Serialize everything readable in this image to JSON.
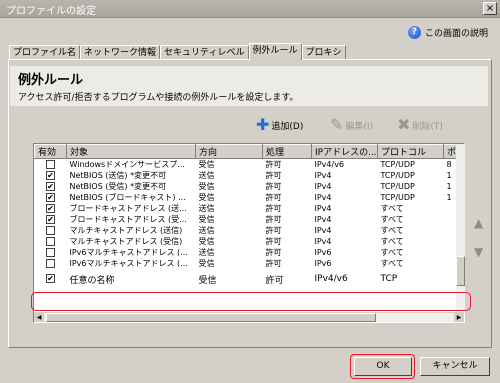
{
  "window": {
    "title": "プロファイルの設定",
    "close_label": "×"
  },
  "help": {
    "label": "この画面の説明",
    "icon": "help-icon"
  },
  "tabs": [
    {
      "label": "プロファイル名"
    },
    {
      "label": "ネットワーク情報"
    },
    {
      "label": "セキュリティレベル"
    },
    {
      "label": "例外ルール",
      "active": true
    },
    {
      "label": "プロキシ"
    }
  ],
  "section": {
    "title": "例外ルール",
    "description": "アクセス許可/拒否するプログラムや接続の例外ルールを設定します。"
  },
  "actions": {
    "add": "追加(D)",
    "edit": "編集(I)",
    "delete": "削除(T)"
  },
  "table": {
    "columns": [
      "有効",
      "対象",
      "方向",
      "処理",
      "IPアドレスの...",
      "プロトコル",
      "ポ"
    ],
    "rows": [
      {
        "checked": false,
        "target": "Windowsドメインサービスプ...",
        "direction": "受信",
        "action": "許可",
        "ip": "IPv4/v6",
        "protocol": "TCP/UDP",
        "port": "8"
      },
      {
        "checked": true,
        "target": "NetBIOS (送信) *変更不可",
        "direction": "送信",
        "action": "許可",
        "ip": "IPv4",
        "protocol": "TCP/UDP",
        "port": "1"
      },
      {
        "checked": true,
        "target": "NetBIOS (受信) *変更不可",
        "direction": "受信",
        "action": "許可",
        "ip": "IPv4",
        "protocol": "TCP/UDP",
        "port": "1"
      },
      {
        "checked": true,
        "target": "NetBIOS (ブロードキャスト) ...",
        "direction": "受信",
        "action": "許可",
        "ip": "IPv4",
        "protocol": "TCP/UDP",
        "port": "1"
      },
      {
        "checked": true,
        "target": "ブロードキャストアドレス (送...",
        "direction": "送信",
        "action": "許可",
        "ip": "IPv4",
        "protocol": "すべて",
        "port": ""
      },
      {
        "checked": true,
        "target": "ブロードキャストアドレス (受...",
        "direction": "受信",
        "action": "許可",
        "ip": "IPv4",
        "protocol": "すべて",
        "port": ""
      },
      {
        "checked": false,
        "target": "マルチキャストアドレス (送信)",
        "direction": "送信",
        "action": "許可",
        "ip": "IPv4",
        "protocol": "すべて",
        "port": ""
      },
      {
        "checked": false,
        "target": "マルチキャストアドレス (受信)",
        "direction": "受信",
        "action": "許可",
        "ip": "IPv4",
        "protocol": "すべて",
        "port": ""
      },
      {
        "checked": false,
        "target": "IPv6マルチキャストアドレス (...",
        "direction": "送信",
        "action": "許可",
        "ip": "IPv6",
        "protocol": "すべて",
        "port": ""
      },
      {
        "checked": false,
        "target": "IPv6マルチキャストアドレス (...",
        "direction": "受信",
        "action": "許可",
        "ip": "IPv6",
        "protocol": "すべて",
        "port": ""
      },
      {
        "checked": true,
        "target": "任意の名称",
        "direction": "受信",
        "action": "許可",
        "ip": "IPv4/v6",
        "protocol": "TCP",
        "port": ""
      }
    ]
  },
  "buttons": {
    "ok": "OK",
    "cancel": "キャンセル"
  },
  "colors": {
    "highlight": "#e5172b",
    "add_icon": "#1f6fe0",
    "dialog_bg": "#d4d0c8"
  }
}
